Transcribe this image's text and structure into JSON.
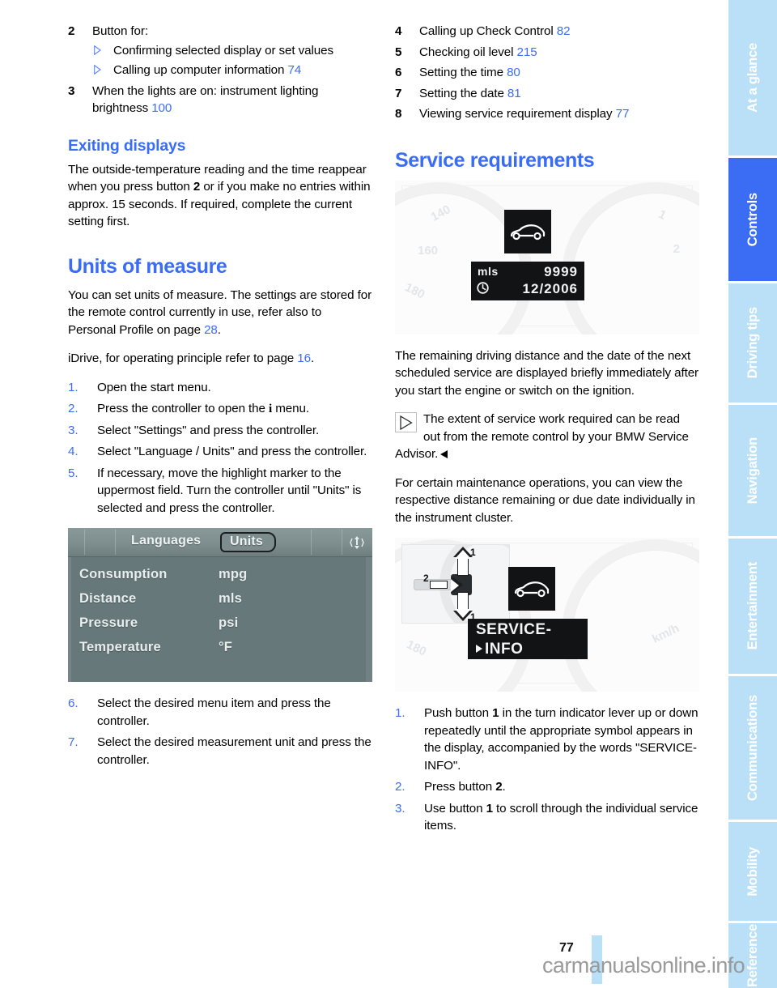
{
  "page": {
    "number": "77",
    "watermark": "carmanualsonline.info"
  },
  "sidebar": {
    "tabs": [
      {
        "label": "At a glance",
        "active": false
      },
      {
        "label": "Controls",
        "active": true
      },
      {
        "label": "Driving tips",
        "active": false
      },
      {
        "label": "Navigation",
        "active": false
      },
      {
        "label": "Entertainment",
        "active": false
      },
      {
        "label": "Communications",
        "active": false
      },
      {
        "label": "Mobility",
        "active": false
      },
      {
        "label": "Reference",
        "active": false
      }
    ],
    "active_color": "#3b6cf4",
    "inactive_color": "#b9e0f7"
  },
  "left_column": {
    "callouts": [
      {
        "number": "2",
        "text": "Button for:",
        "subitems": [
          {
            "text": "Confirming selected display or set values",
            "page": ""
          },
          {
            "text": "Calling up computer information",
            "page": "74"
          }
        ]
      },
      {
        "number": "3",
        "text": "When the lights are on: instrument lighting brightness",
        "page": "100",
        "subitems": []
      }
    ],
    "exiting_displays": {
      "heading": "Exiting displays",
      "paragraph_part1": "The outside-temperature reading and the time reappear when you press button ",
      "paragraph_bold": "2",
      "paragraph_part2": " or if you make no entries within approx. 15 seconds. If required, complete the current setting first."
    },
    "units_of_measure": {
      "heading": "Units of measure",
      "intro_part1": "You can set units of measure. The settings are stored for the remote control currently in use, refer also to Personal Profile on page ",
      "intro_page": "28",
      "intro_part2": ".",
      "idrive_part1": "iDrive, for operating principle refer to page ",
      "idrive_page": "16",
      "idrive_part2": ".",
      "steps_a": [
        {
          "n": "1.",
          "text": "Open the start menu."
        },
        {
          "n": "2.",
          "text": "Press the controller to open the i menu."
        },
        {
          "n": "3.",
          "text": "Select \"Settings\" and press the controller."
        },
        {
          "n": "4.",
          "text": "Select \"Language / Units\" and press the controller."
        },
        {
          "n": "5.",
          "text": "If necessary, move the highlight marker to the uppermost field. Turn the controller until \"Units\" is selected and press the controller."
        }
      ],
      "steps_b": [
        {
          "n": "6.",
          "text": "Select the desired menu item and press the controller."
        },
        {
          "n": "7.",
          "text": "Select the desired measurement unit and press the controller."
        }
      ]
    },
    "idrive_screen": {
      "tab_languages": "Languages",
      "tab_units": "Units",
      "scroll_icon": "up-down-scroll-icon",
      "rows": [
        {
          "label": "Consumption",
          "value": "mpg"
        },
        {
          "label": "Distance",
          "value": "mls"
        },
        {
          "label": "Pressure",
          "value": "psi"
        },
        {
          "label": "Temperature",
          "value": "°F"
        }
      ]
    }
  },
  "right_column": {
    "callouts": [
      {
        "number": "4",
        "text": "Calling up Check Control",
        "page": "82"
      },
      {
        "number": "5",
        "text": "Checking oil level",
        "page": "215"
      },
      {
        "number": "6",
        "text": "Setting the time",
        "page": "80"
      },
      {
        "number": "7",
        "text": "Setting the date",
        "page": "81"
      },
      {
        "number": "8",
        "text": "Viewing service requirement display",
        "page": "77"
      }
    ],
    "service_requirements": {
      "heading": "Service requirements",
      "paragraph1": "The remaining driving distance and the date of the next scheduled service are displayed briefly immediately after you start the engine or switch on the ignition.",
      "note": "The extent of service work required can be read out from the remote control by your BMW Service Advisor.",
      "paragraph2": "For certain maintenance operations, you can view the respective distance remaining or due date individually in the instrument cluster.",
      "steps": [
        {
          "n": "1.",
          "part1": "Push button ",
          "bold": "1",
          "part2": " in the turn indicator lever up or down repeatedly until the appropriate symbol appears in the display, accompanied by the words \"SERVICE-INFO\"."
        },
        {
          "n": "2.",
          "part1": "Press button ",
          "bold": "2",
          "part2": "."
        },
        {
          "n": "3.",
          "part1": "Use button ",
          "bold": "1",
          "part2": " to scroll through the individual service items."
        }
      ]
    },
    "cluster_figure_1": {
      "symbol": "car-side-icon",
      "unit_label": "mls",
      "distance_value": "9999",
      "clock_icon": "clock-icon",
      "date_value": "12/2006"
    },
    "cluster_figure_2": {
      "symbol": "car-side-icon",
      "display_line1": "SERVICE-",
      "display_line2": "INFO",
      "lever_label_1": "1",
      "lever_label_2": "2"
    }
  }
}
